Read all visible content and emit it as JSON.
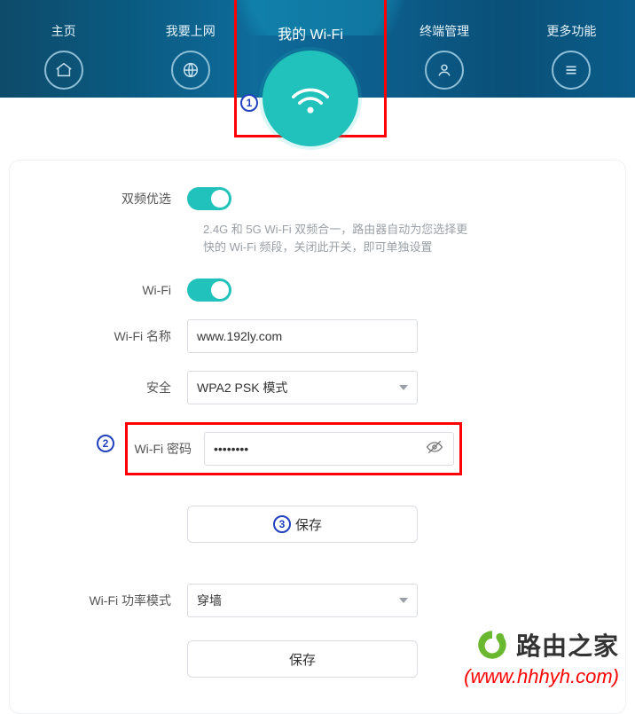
{
  "nav": {
    "home": "主页",
    "internet": "我要上网",
    "wifi": "我的 Wi-Fi",
    "clients": "终端管理",
    "more": "更多功能"
  },
  "badges": {
    "b1": "1",
    "b2": "2",
    "b3": "3"
  },
  "form": {
    "dualband_label": "双频优选",
    "dualband_hint": "2.4G 和 5G Wi-Fi 双频合一，路由器自动为您选择更快的 Wi-Fi 频段，关闭此开关，即可单独设置",
    "wifi_label": "Wi-Fi",
    "name_label": "Wi-Fi 名称",
    "name_value": "www.192ly.com",
    "security_label": "安全",
    "security_value": "WPA2 PSK 模式",
    "pwd_label": "Wi-Fi 密码",
    "pwd_value": "••••••••",
    "save1": "保存",
    "power_label": "Wi-Fi 功率模式",
    "power_value": "穿墙",
    "save2": "保存"
  },
  "brand": {
    "name": "路由之家",
    "url": "(www.hhhyh.com)"
  }
}
